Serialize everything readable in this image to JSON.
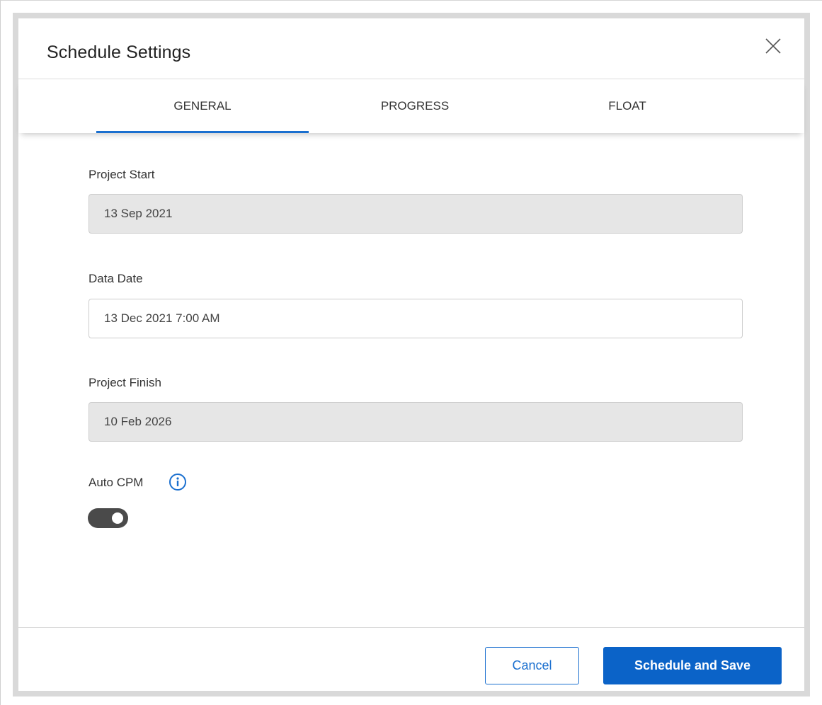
{
  "dialog": {
    "title": "Schedule Settings"
  },
  "tabs": [
    {
      "label": "GENERAL",
      "active": true
    },
    {
      "label": "PROGRESS",
      "active": false
    },
    {
      "label": "FLOAT",
      "active": false
    }
  ],
  "fields": {
    "project_start": {
      "label": "Project Start",
      "value": "13 Sep 2021",
      "readonly": true
    },
    "data_date": {
      "label": "Data Date",
      "value": "13 Dec 2021 7:00 AM",
      "readonly": false
    },
    "project_finish": {
      "label": "Project Finish",
      "value": "10 Feb 2026",
      "readonly": true
    }
  },
  "auto_cpm": {
    "label": "Auto CPM",
    "enabled": true,
    "info_icon": "info-circle-icon"
  },
  "footer": {
    "cancel_label": "Cancel",
    "primary_label": "Schedule and Save"
  },
  "colors": {
    "accent": "#1a6fcf",
    "primary_button": "#0b63c8",
    "readonly_field": "#e6e6e6",
    "toggle_track": "#4a4a4a"
  }
}
